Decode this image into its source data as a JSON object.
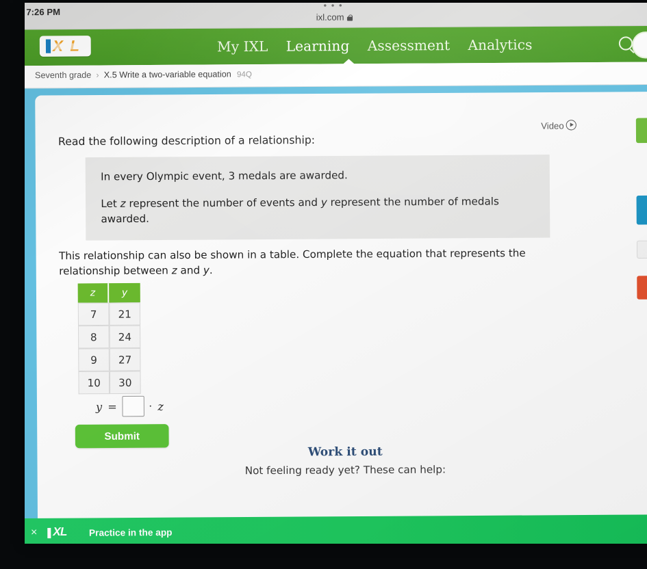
{
  "browser": {
    "clock": "7:26 PM",
    "menu_dots": "•••",
    "url": "ixl.com"
  },
  "nav": {
    "logo": {
      "i": "I",
      "x": "X",
      "l": "L"
    },
    "items": [
      {
        "label": "My IXL",
        "active": false
      },
      {
        "label": "Learning",
        "active": true
      },
      {
        "label": "Assessment",
        "active": false
      },
      {
        "label": "Analytics",
        "active": false
      }
    ],
    "search_icon": "search-icon",
    "avatar": "avatar"
  },
  "breadcrumb": {
    "grade": "Seventh grade",
    "separator": "›",
    "lesson": "X.5 Write a two-variable equation",
    "question_count": "94Q"
  },
  "content": {
    "video_label": "Video",
    "prompt": "Read the following description of a relationship:",
    "description": {
      "line1": "In every Olympic event, 3 medals are awarded.",
      "line2_a": "Let ",
      "line2_var1": "z",
      "line2_b": " represent the number of events and ",
      "line2_var2": "y",
      "line2_c": " represent the number of medals awarded."
    },
    "instruction_a": "This relationship can also be shown in a table. Complete the equation that represents the relationship between ",
    "instruction_var1": "z",
    "instruction_mid": " and ",
    "instruction_var2": "y",
    "instruction_end": ".",
    "table": {
      "headers": [
        "z",
        "y"
      ],
      "rows": [
        [
          "7",
          "21"
        ],
        [
          "8",
          "24"
        ],
        [
          "9",
          "27"
        ],
        [
          "10",
          "30"
        ]
      ]
    },
    "equation": {
      "lhs": "y",
      "equals": "=",
      "answer_value": "",
      "answer_placeholder": "",
      "operator": "·",
      "rhs": "z"
    },
    "submit_label": "Submit",
    "work_it_out": "Work it out",
    "ready_line": "Not feeling ready yet? These can help:"
  },
  "app_banner": {
    "close": "×",
    "logo_i": "I",
    "logo_x": "XL",
    "text": "Practice in the app"
  },
  "colors": {
    "nav_green": "#4a9a27",
    "submit_green": "#5cc238",
    "table_header_green": "#6bb92e",
    "page_blue": "#63bfe0",
    "banner_green": "#1fc95f",
    "work_it_out_blue": "#2f4f79"
  }
}
